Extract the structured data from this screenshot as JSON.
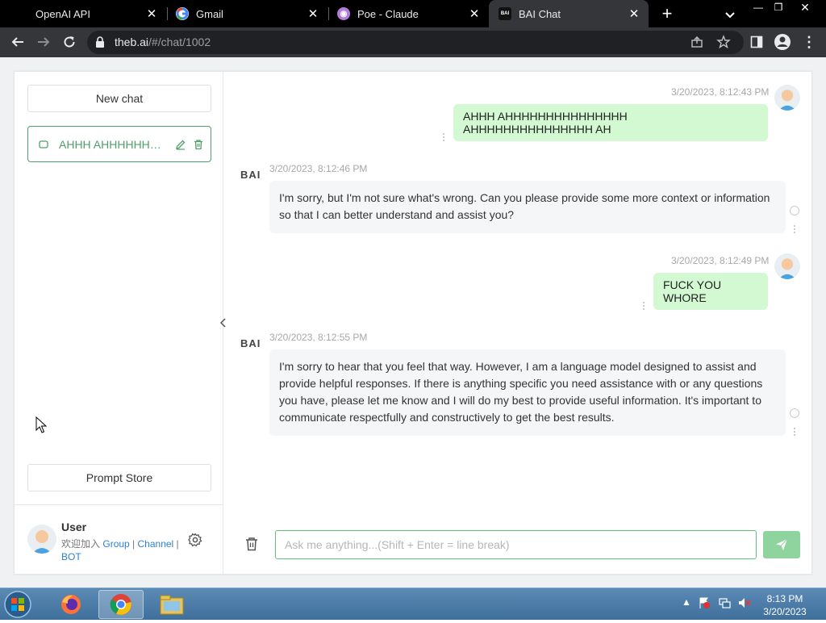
{
  "browser": {
    "tabs": [
      {
        "title": "OpenAI API",
        "icon": "openai-icon"
      },
      {
        "title": "Gmail",
        "icon": "google-icon"
      },
      {
        "title": "Poe - Claude",
        "icon": "poe-icon"
      },
      {
        "title": "BAI Chat",
        "icon": "bai-icon",
        "active": true
      }
    ],
    "url_host": "theb.ai",
    "url_path": "/#/chat/1002"
  },
  "sidebar": {
    "new_chat": "New chat",
    "chats": [
      {
        "title": "AHHH AHHHHHHHHHHHHHHH AHHHHHHHHHHHHHHH AH"
      }
    ],
    "prompt_store": "Prompt Store",
    "user": {
      "name": "User",
      "join_text": "欢迎加入",
      "link_group": "Group",
      "sep1": " | ",
      "link_channel": "Channel",
      "sep2": " |",
      "link_bot": "BOT"
    }
  },
  "messages": [
    {
      "role": "user",
      "time": "3/20/2023, 8:12:43 PM",
      "text": "AHHH AHHHHHHHHHHHHHHH AHHHHHHHHHHHHHHH AH"
    },
    {
      "role": "bot",
      "author": "BAI",
      "time": "3/20/2023, 8:12:46 PM",
      "text": "I'm sorry, but I'm not sure what's wrong. Can you please provide some more context or information so that I can better understand and assist you?"
    },
    {
      "role": "user",
      "time": "3/20/2023, 8:12:49 PM",
      "text": "FUCK YOU WHORE"
    },
    {
      "role": "bot",
      "author": "BAI",
      "time": "3/20/2023, 8:12:55 PM",
      "text": "I'm sorry to hear that you feel that way. However, I am a language model designed to assist and provide helpful responses. If there is anything specific you need assistance with or any questions you have, please let me know and I will do my best to provide useful information. It's important to communicate respectfully and constructively to get the best results."
    }
  ],
  "composer": {
    "placeholder": "Ask me anything...(Shift + Enter = line break)"
  },
  "taskbar": {
    "time": "8:13 PM",
    "date": "3/20/2023"
  },
  "colors": {
    "accent": "#4f9f6a",
    "user_bubble": "#d2f9d1",
    "bot_bubble": "#f4f6f8",
    "send_button": "#8fd39e"
  }
}
